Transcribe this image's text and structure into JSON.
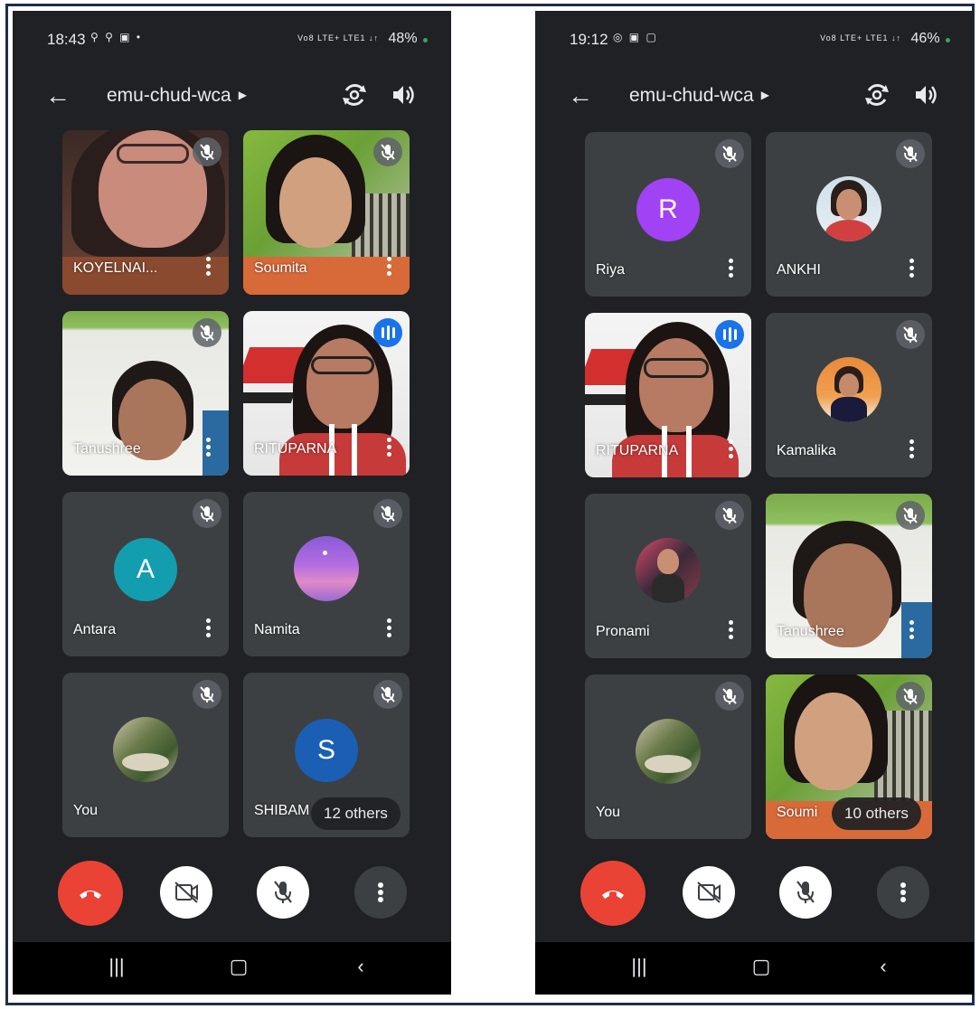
{
  "left": {
    "status": {
      "time": "18:43",
      "extra": "⚲ ⚲ ▣ •",
      "signal": "Vo8 LTE+ LTE1 ↓↑",
      "battery": "48%"
    },
    "meeting_title": "emu-chud-wca",
    "tiles": [
      {
        "name": "KOYELNAI..."
      },
      {
        "name": "Soumita"
      },
      {
        "name": "Tanushree"
      },
      {
        "name": "RITUPARNA"
      },
      {
        "name": "Antara",
        "initial": "A"
      },
      {
        "name": "Namita"
      },
      {
        "name": "You"
      },
      {
        "name": "SHIBAM",
        "initial": "S"
      }
    ],
    "others": "12 others"
  },
  "right": {
    "status": {
      "time": "19:12",
      "extra": "◎ ▣ ▢",
      "signal": "Vo8 LTE+ LTE1 ↓↑",
      "battery": "46%"
    },
    "meeting_title": "emu-chud-wca",
    "tiles": [
      {
        "name": "Riya",
        "initial": "R"
      },
      {
        "name": "ANKHI"
      },
      {
        "name": "RITUPARNA"
      },
      {
        "name": "Kamalika"
      },
      {
        "name": "Pronami"
      },
      {
        "name": "Tanushree"
      },
      {
        "name": "You"
      },
      {
        "name": "Soumi"
      }
    ],
    "others": "10 others"
  },
  "colors": {
    "background": "#202124",
    "tile": "#3c4043",
    "end_call": "#ea4335",
    "avatar_teal": "#129eaf",
    "avatar_blue": "#1a5fb4",
    "avatar_purple": "#a142f4",
    "speaking": "#1a73e8"
  },
  "icons": [
    "back-arrow-icon",
    "caret-right-icon",
    "switch-camera-icon",
    "speaker-icon",
    "mic-off-icon",
    "more-vert-icon",
    "end-call-icon",
    "camera-off-icon",
    "recents-icon",
    "home-icon",
    "back-nav-icon"
  ]
}
